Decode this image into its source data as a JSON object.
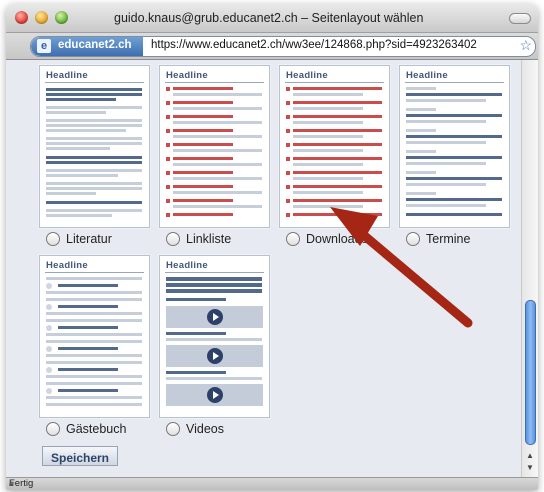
{
  "window": {
    "title": "guido.knaus@grub.educanet2.ch – Seitenlayout wählen"
  },
  "urlbar": {
    "site": "educanet2.ch",
    "url": "https://www.educanet2.ch/ww3ee/124868.php?sid=4923263402"
  },
  "layouts": [
    {
      "label": "Literatur",
      "headline": "Headline"
    },
    {
      "label": "Linkliste",
      "headline": "Headline"
    },
    {
      "label": "Downloads",
      "headline": "Headline"
    },
    {
      "label": "Termine",
      "headline": "Headline"
    },
    {
      "label": "Gästebuch",
      "headline": "Headline"
    },
    {
      "label": "Videos",
      "headline": "Headline"
    }
  ],
  "save_button": "Speichern",
  "status": "Fertig",
  "colors": {
    "annotation_arrow": "#a52614",
    "scrollbar": "#6aa0e4"
  }
}
